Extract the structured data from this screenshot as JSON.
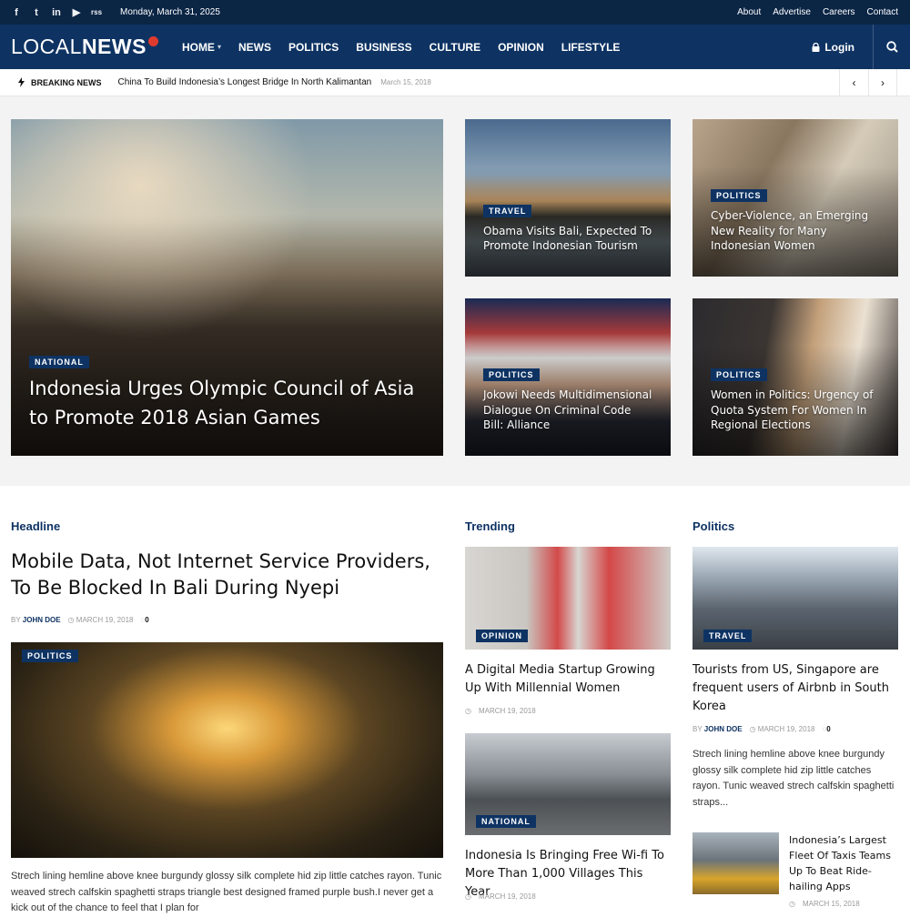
{
  "topbar": {
    "social_icons": [
      "f",
      "t",
      "in",
      "▶",
      "rss"
    ],
    "date": "Monday, March 31, 2025",
    "links": [
      "About",
      "Advertise",
      "Careers",
      "Contact"
    ]
  },
  "nav": {
    "logo_left": "LOCAL",
    "logo_right": "NEWS",
    "items": [
      "HOME",
      "NEWS",
      "POLITICS",
      "BUSINESS",
      "CULTURE",
      "OPINION",
      "LIFESTYLE"
    ],
    "login": "Login"
  },
  "breaking": {
    "label": "BREAKING NEWS",
    "title": "China To Build Indonesia’s Longest Bridge In North Kalimantan",
    "date": "March 15, 2018"
  },
  "hero": {
    "main": {
      "tag": "NATIONAL",
      "title": "Indonesia Urges Olympic Council of Asia to Promote 2018 Asian Games"
    },
    "cards": [
      {
        "tag": "TRAVEL",
        "title": "Obama Visits Bali, Expected To Promote Indonesian Tourism"
      },
      {
        "tag": "POLITICS",
        "title": "Cyber-Violence, an Emerging New Reality for Many Indonesian Women"
      },
      {
        "tag": "POLITICS",
        "title": "Jokowi Needs Multidimensional Dialogue On Criminal Code Bill: Alliance"
      },
      {
        "tag": "POLITICS",
        "title": "Women in Politics: Urgency of Quota System For Women In Regional Elections"
      }
    ]
  },
  "headline": {
    "section": "Headline",
    "title": "Mobile Data, Not Internet Service Providers, To Be Blocked In Bali During Nyepi",
    "by": "BY",
    "author": "JOHN DOE",
    "date": "MARCH 19, 2018",
    "comments": "0",
    "image_tag": "POLITICS",
    "excerpt": "Strech lining hemline above knee burgundy glossy silk complete hid zip little catches rayon. Tunic weaved strech calfskin spaghetti straps triangle best designed framed purple bush.I never get a kick out of the chance to feel that I plan for"
  },
  "trending": {
    "section": "Trending",
    "items": [
      {
        "tag": "OPINION",
        "title": "A Digital Media Startup Growing Up With Millennial Women",
        "date": "MARCH 19, 2018"
      },
      {
        "tag": "NATIONAL",
        "title": "Indonesia Is Bringing Free Wi-fi To More Than 1,000 Villages This Year",
        "date": "MARCH 19, 2018"
      }
    ]
  },
  "politics": {
    "section": "Politics",
    "main": {
      "tag": "TRAVEL",
      "title": "Tourists from US, Singapore are frequent users of Airbnb in South Korea",
      "by": "BY",
      "author": "JOHN DOE",
      "date": "MARCH 19, 2018",
      "comments": "0",
      "excerpt": "Strech lining hemline above knee burgundy glossy silk complete hid zip little catches rayon. Tunic weaved strech calfskin spaghetti straps..."
    },
    "small": {
      "title": "Indonesia’s Largest Fleet Of Taxis Teams Up To Beat Ride-hailing Apps",
      "date": "MARCH 15, 2018"
    }
  }
}
